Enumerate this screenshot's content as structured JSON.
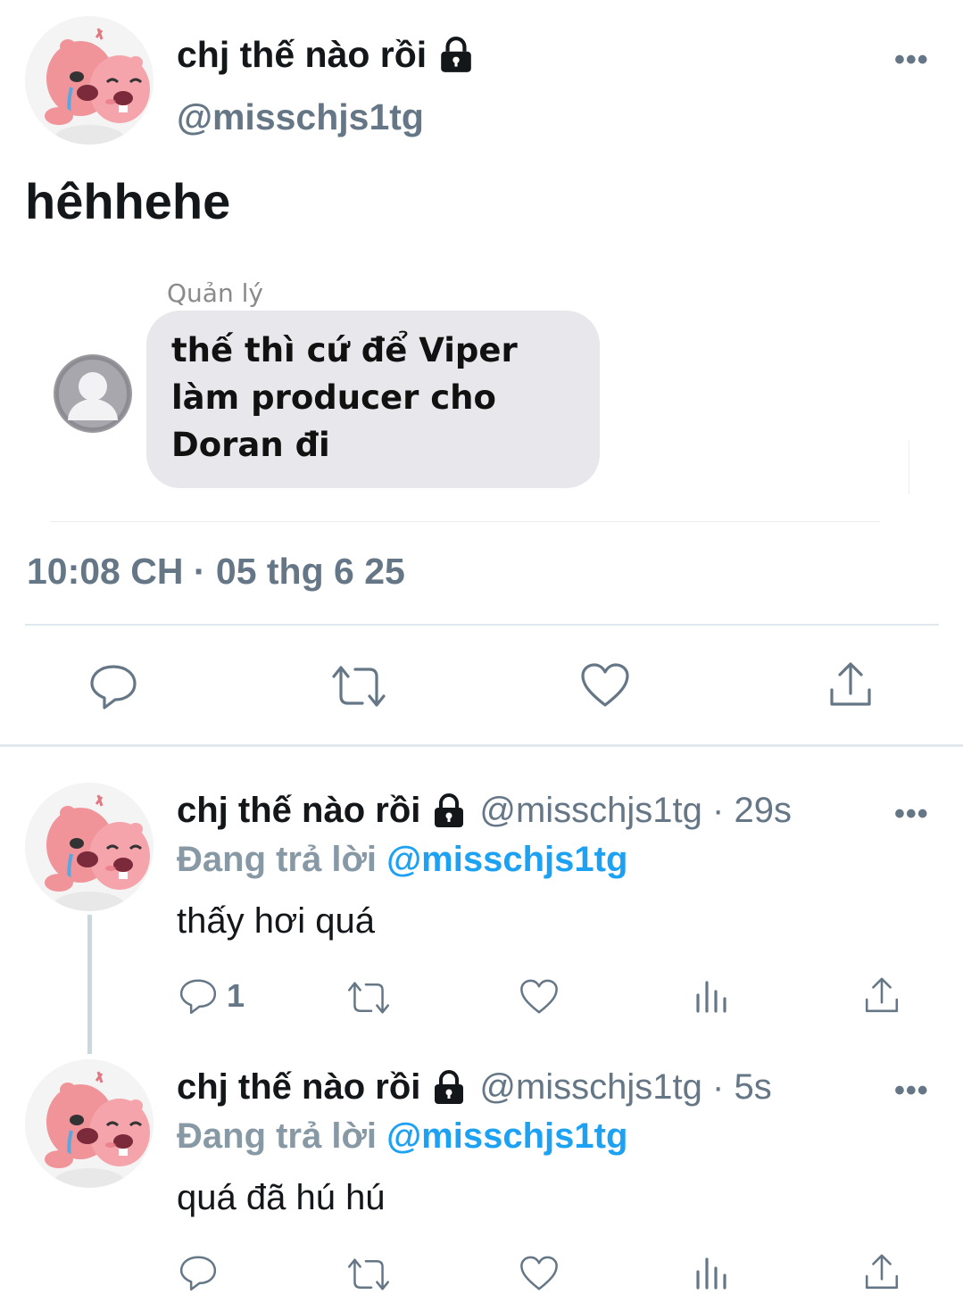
{
  "tweet": {
    "display_name": "chj thế nào rồi",
    "handle": "@misschjs1tg",
    "text": "hêhhehe",
    "timestamp": "10:08 CH · 05 thg 6 25",
    "more": "•••",
    "embedded_image": {
      "sender_label": "Quản lý",
      "message": "thế thì cứ để Viper làm producer cho Doran đi"
    }
  },
  "replies": [
    {
      "display_name": "chj thế nào rồi",
      "handle_time": "@misschjs1tg · 29s",
      "replying_prefix": "Đang trả lời",
      "replying_to": "@misschjs1tg",
      "text": "thấy hơi quá",
      "reply_count": "1",
      "more": "•••"
    },
    {
      "display_name": "chj thế nào rồi",
      "handle_time": "@misschjs1tg · 5s",
      "replying_prefix": "Đang trả lời",
      "replying_to": "@misschjs1tg",
      "text": "quá đã hú hú",
      "reply_count": "",
      "more": "•••"
    }
  ],
  "icons": {
    "avatar": "pink-beaver-avatar-icon",
    "lock": "lock-icon",
    "reply": "reply-bubble-icon",
    "retweet": "retweet-icon",
    "like": "heart-icon",
    "analytics": "analytics-icon",
    "share": "share-icon",
    "chat_avatar": "default-person-icon"
  },
  "colors": {
    "accent": "#1da1f2",
    "secondary_text": "#657786",
    "divider": "#e1e8ed",
    "bubble": "#e8e8ec"
  }
}
